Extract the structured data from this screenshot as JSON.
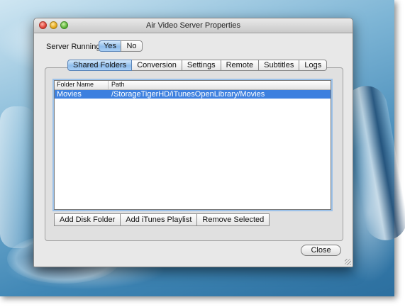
{
  "window": {
    "title": "Air Video Server Properties"
  },
  "server": {
    "label": "Server Running",
    "options": [
      "Yes",
      "No"
    ],
    "selected": "Yes"
  },
  "tabs": [
    {
      "label": "Shared Folders",
      "active": true
    },
    {
      "label": "Conversion",
      "active": false
    },
    {
      "label": "Settings",
      "active": false
    },
    {
      "label": "Remote",
      "active": false
    },
    {
      "label": "Subtitles",
      "active": false
    },
    {
      "label": "Logs",
      "active": false
    }
  ],
  "table": {
    "columns": [
      "Folder Name",
      "Path"
    ],
    "rows": [
      {
        "name": "Movies",
        "path": "/StorageTigerHD/iTunesOpenLibrary/Movies",
        "selected": true
      }
    ]
  },
  "buttons": {
    "add_folder": "Add Disk Folder",
    "add_playlist": "Add iTunes Playlist",
    "remove": "Remove Selected",
    "close": "Close"
  },
  "colors": {
    "selection": "#3d80df",
    "active_tab": "#8fbdec"
  },
  "icons": [
    "close-window-icon",
    "minimize-window-icon",
    "zoom-window-icon",
    "resize-grip-icon"
  ]
}
